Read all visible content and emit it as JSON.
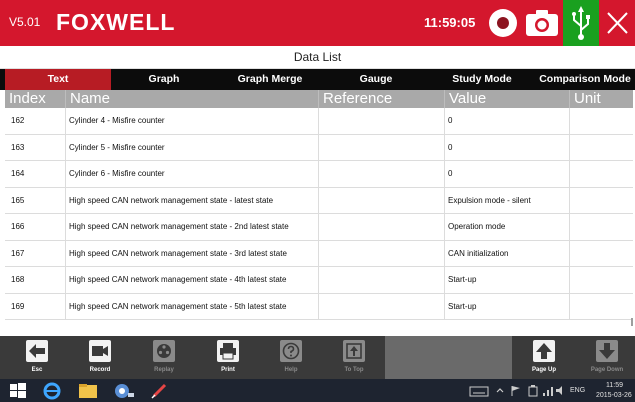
{
  "header": {
    "version": "V5.01",
    "brand": "FOXWELL",
    "time": "11:59:05",
    "colors": {
      "brand_red": "#d4172d",
      "usb_green": "#1aa01f"
    },
    "icons": [
      "record-icon",
      "camera-icon",
      "usb-icon",
      "close-icon"
    ]
  },
  "page": {
    "title": "Data List"
  },
  "tabs": [
    {
      "label": "Text",
      "active": true
    },
    {
      "label": "Graph",
      "active": false
    },
    {
      "label": "Graph Merge",
      "active": false
    },
    {
      "label": "Gauge",
      "active": false
    },
    {
      "label": "Study Mode",
      "active": false
    },
    {
      "label": "Comparison Mode",
      "active": false
    }
  ],
  "table": {
    "columns": [
      "Index",
      "Name",
      "Reference",
      "Value",
      "Unit"
    ],
    "rows": [
      {
        "index": "162",
        "name": "Cylinder 4  -  Misfire counter",
        "reference": "",
        "value": "0",
        "unit": ""
      },
      {
        "index": "163",
        "name": "Cylinder 5  -  Misfire counter",
        "reference": "",
        "value": "0",
        "unit": ""
      },
      {
        "index": "164",
        "name": "Cylinder 6  -  Misfire counter",
        "reference": "",
        "value": "0",
        "unit": ""
      },
      {
        "index": "165",
        "name": "High speed CAN network management state - latest state",
        "reference": "",
        "value": "Expulsion mode - silent",
        "unit": ""
      },
      {
        "index": "166",
        "name": "High speed CAN network management state - 2nd latest state",
        "reference": "",
        "value": "Operation mode",
        "unit": ""
      },
      {
        "index": "167",
        "name": "High speed CAN network management state - 3rd latest state",
        "reference": "",
        "value": "CAN initialization",
        "unit": ""
      },
      {
        "index": "168",
        "name": "High speed CAN network management state - 4th latest state",
        "reference": "",
        "value": "Start-up",
        "unit": ""
      },
      {
        "index": "169",
        "name": "High speed CAN network management state - 5th latest state",
        "reference": "",
        "value": "Start-up",
        "unit": ""
      }
    ]
  },
  "toolbar": {
    "esc": "Esc",
    "record": "Record",
    "replay": "Replay",
    "print": "Print",
    "help": "Help",
    "to_top": "To Top",
    "page_up": "Page Up",
    "page_down": "Page Down"
  },
  "taskbar": {
    "language": "ENG",
    "time": "11:59",
    "date": "2015-03-26"
  }
}
